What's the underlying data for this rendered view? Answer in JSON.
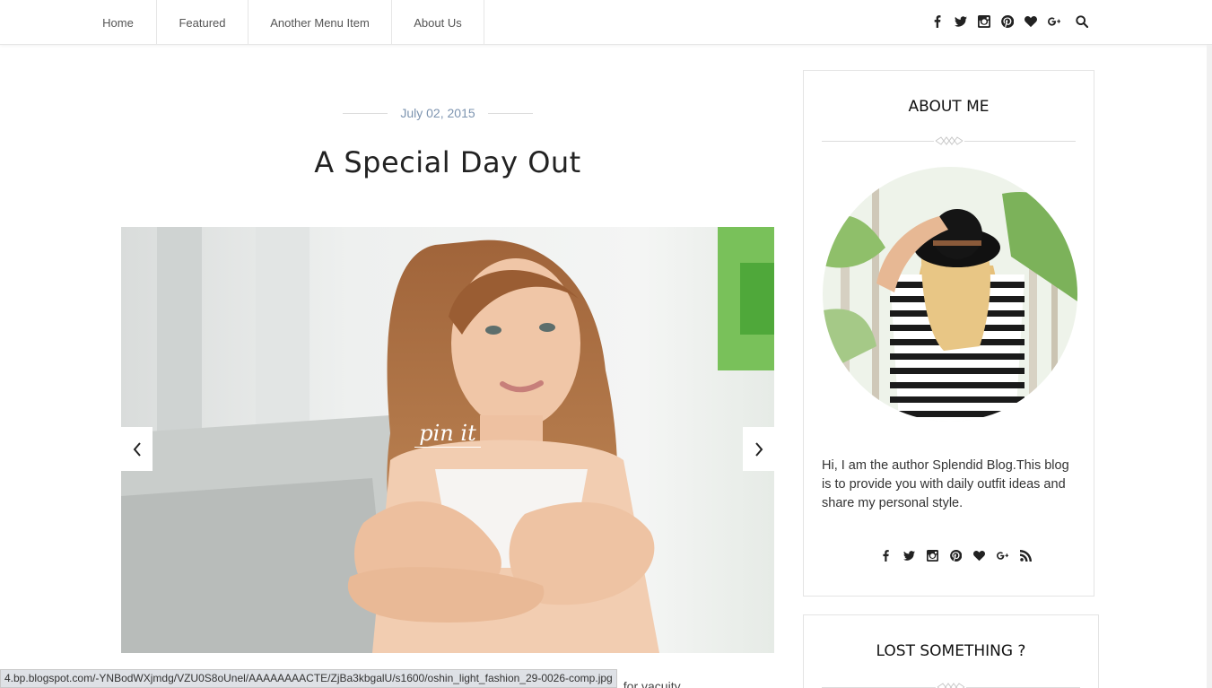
{
  "nav": {
    "items": [
      {
        "label": "Home"
      },
      {
        "label": "Featured"
      },
      {
        "label": "Another Menu Item"
      },
      {
        "label": "About Us"
      }
    ],
    "social_icons": [
      "facebook-icon",
      "twitter-icon",
      "instagram-icon",
      "pinterest-icon",
      "heart-icon",
      "google-plus-icon"
    ],
    "search_icon": "search-icon"
  },
  "post": {
    "date": "July 02, 2015",
    "title": "A Special Day Out",
    "image_overlay": "pin it",
    "peek_text": "s. for vacuity"
  },
  "sidebar": {
    "about": {
      "title": "ABOUT ME",
      "bio": "Hi, I am the author Splendid Blog.This blog is to provide you with daily outfit ideas and share my personal style.",
      "social_icons": [
        "facebook-icon",
        "twitter-icon",
        "instagram-icon",
        "pinterest-icon",
        "heart-icon",
        "google-plus-icon",
        "rss-icon"
      ]
    },
    "lost": {
      "title": "LOST SOMETHING ?"
    }
  },
  "status_bar": {
    "url": "4.bp.blogspot.com/-YNBodWXjmdg/VZU0S8oUnel/AAAAAAAACTE/ZjBa3kbgalU/s1600/oshin_light_fashion_29-0026-comp.jpg"
  },
  "colors": {
    "accent_date": "#7d94b0",
    "text": "#333333",
    "border": "#e4e4e4"
  }
}
